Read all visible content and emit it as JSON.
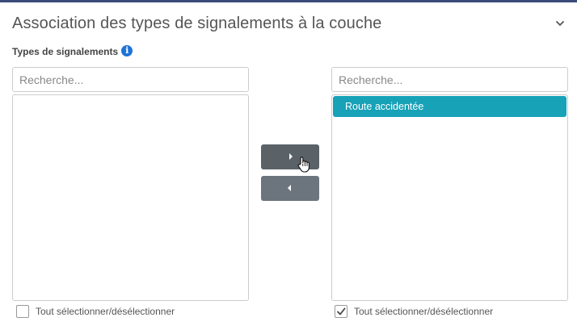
{
  "panel": {
    "title": "Association des types de signalements à la couche",
    "collapse_icon": "chevron-down-icon"
  },
  "field": {
    "label": "Types de signalements",
    "info_icon": "info-icon",
    "info_glyph": "i"
  },
  "available": {
    "search_placeholder": "Recherche...",
    "items": [],
    "select_all_label": "Tout sélectionner/désélectionner",
    "select_all_checked": false
  },
  "selected": {
    "search_placeholder": "Recherche...",
    "items": [
      "Route accidentée"
    ],
    "select_all_label": "Tout sélectionner/désélectionner",
    "select_all_checked": true
  },
  "controls": {
    "move_right_icon": "caret-right-icon",
    "move_left_icon": "caret-left-icon"
  },
  "colors": {
    "accent": "#17a2b8",
    "button": "#6c757d",
    "info": "#1e73d6",
    "top_border": "#3c4a7a"
  }
}
